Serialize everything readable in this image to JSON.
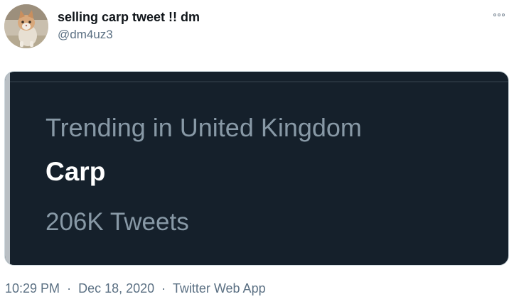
{
  "tweet": {
    "display_name": "selling carp tweet !! dm",
    "handle": "@dm4uz3",
    "more_icon": "more-horizontal-icon",
    "avatar_icon": "cat-avatar"
  },
  "media": {
    "trend_context": "Trending in United Kingdom",
    "trend_name": "Carp",
    "trend_count": "206K Tweets"
  },
  "meta": {
    "time": "10:29 PM",
    "separator": "·",
    "date": "Dec 18, 2020",
    "source": "Twitter Web App"
  },
  "colors": {
    "background": "#ffffff",
    "card_background": "#15202b",
    "muted_text": "#8899a6",
    "handle_text": "#5b7083"
  }
}
